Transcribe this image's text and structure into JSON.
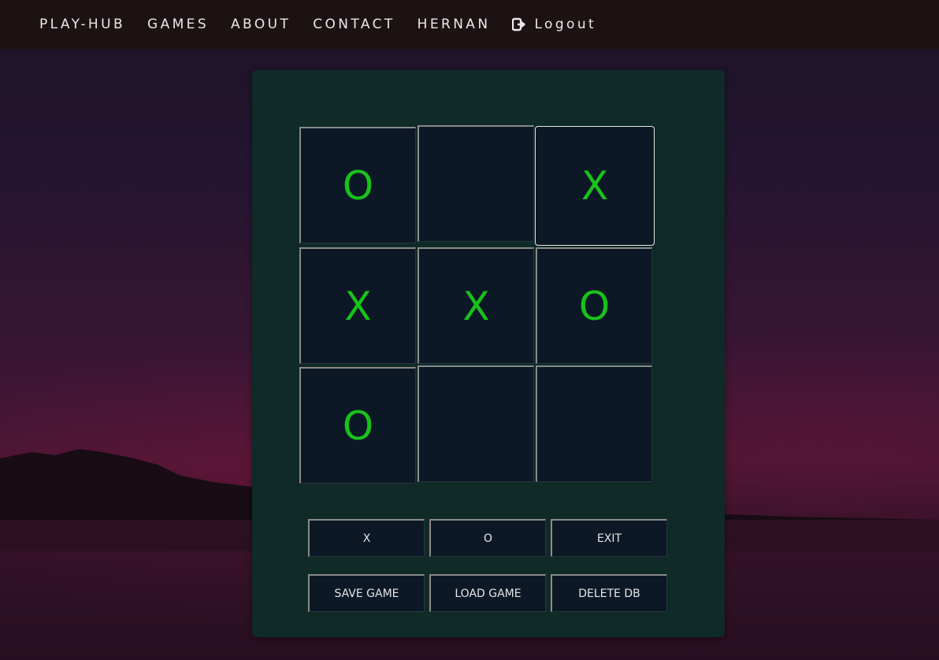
{
  "nav": {
    "brand": "PLAY-HUB",
    "games": "GAMES",
    "about": "ABOUT",
    "contact": "CONTACT",
    "user": "HERNAN",
    "logout": "Logout",
    "logout_icon": "logout-icon"
  },
  "board": {
    "cells": [
      "O",
      "",
      "X",
      "X",
      "X",
      "O",
      "O",
      "",
      ""
    ],
    "mark_color": "#18c21a"
  },
  "controls": {
    "x_label": "X",
    "o_label": "O",
    "exit_label": "EXIT",
    "save_label": "SAVE GAME",
    "load_label": "LOAD GAME",
    "delete_label": "DELETE DB"
  },
  "colors": {
    "navbar": "#1d1213",
    "panel": "#0f2a27",
    "cell": "#0d1826"
  }
}
